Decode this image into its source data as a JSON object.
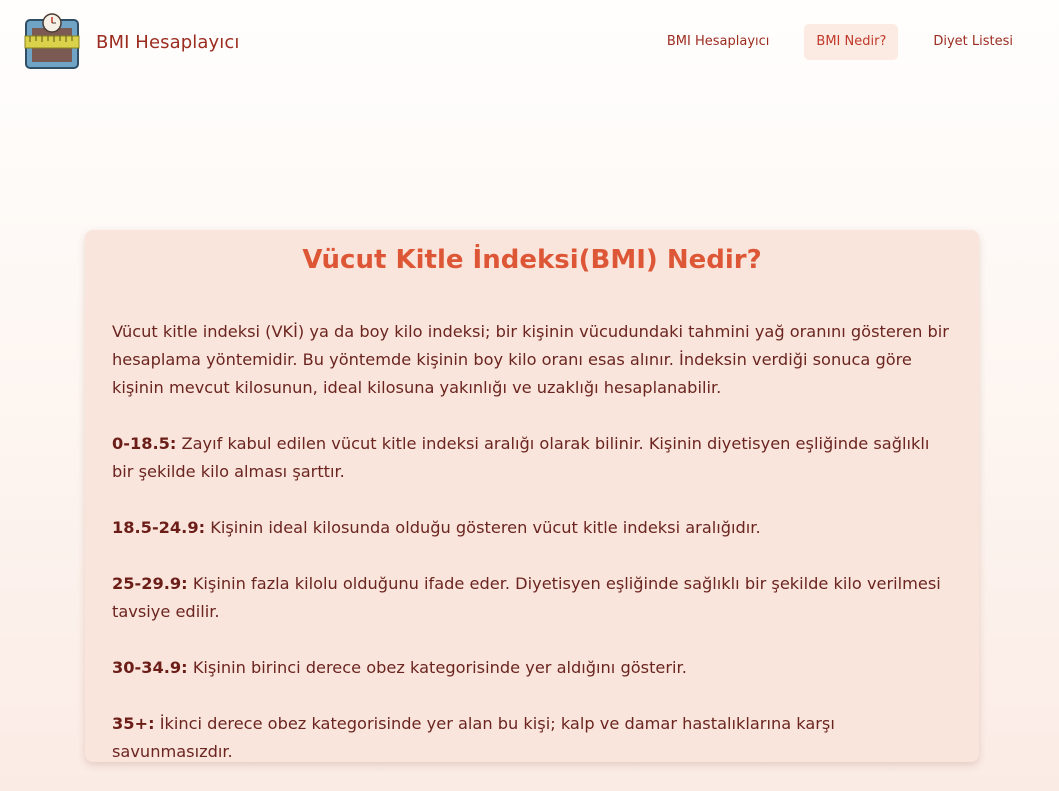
{
  "header": {
    "brand_name": "BMI Hesaplayıcı",
    "logo_icon": "scale-measuring-tape-logo",
    "nav": [
      {
        "label": "BMI Hesaplayıcı",
        "active": false
      },
      {
        "label": "BMI Nedir?",
        "active": true
      },
      {
        "label": "Diyet Listesi",
        "active": false
      }
    ]
  },
  "content": {
    "title": "Vücut Kitle İndeksi(BMI) Nedir?",
    "intro": "Vücut kitle indeksi (VKİ) ya da boy kilo indeksi; bir kişinin vücudundaki tahmini yağ oranını gösteren bir hesaplama yöntemidir. Bu yöntemde kişinin boy kilo oranı esas alınır. İndeksin verdiği sonuca göre kişinin mevcut kilosunun, ideal kilosuna yakınlığı ve uzaklığı hesaplanabilir.",
    "ranges": [
      {
        "range": "0-18.5:",
        "text": " Zayıf kabul edilen vücut kitle indeksi aralığı olarak bilinir. Kişinin diyetisyen eşliğinde sağlıklı bir şekilde kilo alması şarttır."
      },
      {
        "range": "18.5-24.9:",
        "text": " Kişinin ideal kilosunda olduğu gösteren vücut kitle indeksi aralığıdır."
      },
      {
        "range": "25-29.9:",
        "text": " Kişinin fazla kilolu olduğunu ifade eder. Diyetisyen eşliğinde sağlıklı bir şekilde kilo verilmesi tavsiye edilir."
      },
      {
        "range": "30-34.9:",
        "text": " Kişinin birinci derece obez kategorisinde yer aldığını gösterir."
      },
      {
        "range": "35+:",
        "text": " İkinci derece obez kategorisinde yer alan bu kişi; kalp ve damar hastalıklarına karşı savunmasızdır."
      }
    ]
  },
  "colors": {
    "brand": "#9b2c1f",
    "title": "#dd5736",
    "card_bg": "#fae5dc",
    "active_nav_bg": "#fbebe3"
  }
}
